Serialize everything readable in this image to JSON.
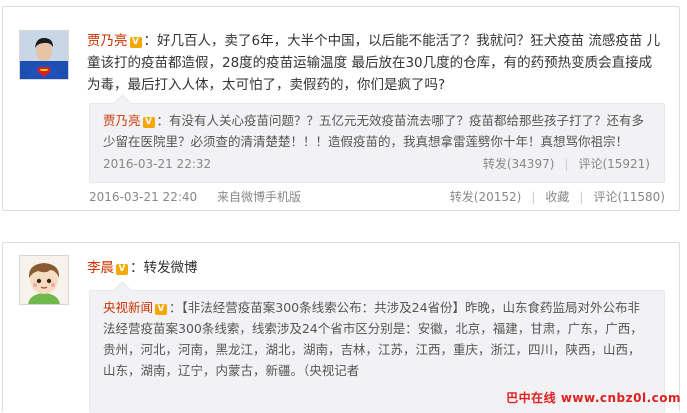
{
  "post1": {
    "author": "贾乃亮",
    "v": "V",
    "text": "：好几百人，卖了6年，大半个中国，以后能不能活了？我就问？狂犬疫苗 流感疫苗 儿童该打的疫苗都造假，28度的疫苗运输温度 最后放在30几度的仓库，有的药预热变质会直接成为毒，最后打入人体，太可怕了，卖假药的，你们是疯了吗?",
    "quote": {
      "author": "贾乃亮",
      "v": "V",
      "text": "：有没有人关心疫苗问题？？五亿元无效疫苗流去哪了？疫苗都给那些孩子打了？还有多少留在医院里？必须查的清清楚楚！！！造假疫苗的，我真想拿雷莲劈你十年！真想骂你祖宗！",
      "time": "2016-03-21 22:32",
      "repost": "转发(34397)",
      "comment": "评论(15921)"
    },
    "time": "2016-03-21 22:40",
    "source": "来自微博手机版",
    "repost": "转发(20152)",
    "fav": "收藏",
    "comment": "评论(11580)"
  },
  "post2": {
    "author": "李晨",
    "v": "V",
    "text": "：转发微博",
    "quote": {
      "author": "央视新闻",
      "v": "V",
      "text": "：【非法经营疫苗案300条线索公布：共涉及24省份】昨晚，山东食药监局对外公布非法经营疫苗案300条线索，线索涉及24个省市区分别是：安徽，北京，福建，甘肃，广东，广西，贵州，河北，河南，黑龙江，湖北，湖南，吉林，江苏，江西，重庆，浙江，四川，陕西，山西，山东，湖南，辽宁，内蒙古，新疆。（央视记者"
    }
  },
  "watermark": "巴中在线 www.cnbz0l.com"
}
